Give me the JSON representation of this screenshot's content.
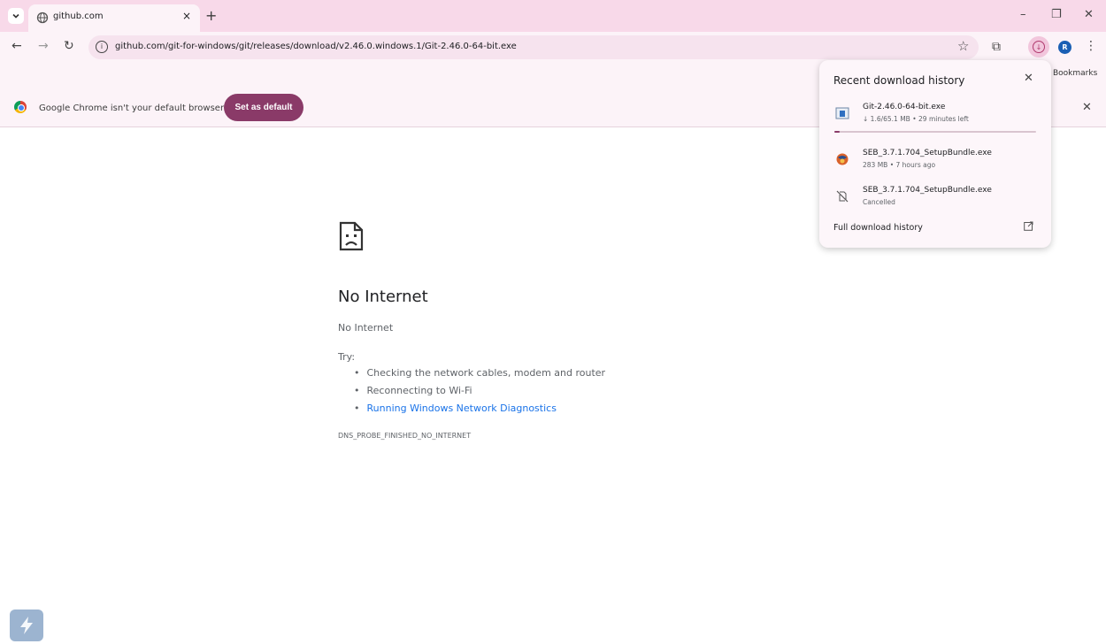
{
  "tab": {
    "title": "github.com",
    "close_glyph": "×",
    "new_tab_glyph": "+",
    "favicon": "globe-icon"
  },
  "window_controls": {
    "minimize": "–",
    "restore": "❐",
    "close": "✕"
  },
  "toolbar": {
    "url": "github.com/git-for-windows/git/releases/download/v2.46.0.windows.1/Git-2.46.0-64-bit.exe",
    "avatar_letter": "R",
    "bookmarks_label": "Bookmarks"
  },
  "infobar": {
    "message": "Google Chrome isn't your default browser",
    "button": "Set as default"
  },
  "error": {
    "title": "No Internet",
    "subtitle": "No Internet",
    "try_label": "Try:",
    "suggestions": [
      "Checking the network cables, modem and router",
      "Reconnecting to Wi-Fi",
      "Running Windows Network Diagnostics"
    ],
    "code": "DNS_PROBE_FINISHED_NO_INTERNET"
  },
  "downloads": {
    "header": "Recent download history",
    "items": [
      {
        "name": "Git-2.46.0-64-bit.exe",
        "meta": "↓ 1.6/65.1 MB • 29 minutes left",
        "progress": 0.025,
        "icon": "installer-icon"
      },
      {
        "name": "SEB_3.7.1.704_SetupBundle.exe",
        "meta": "283 MB • 7 hours ago",
        "icon": "seb-icon"
      },
      {
        "name": "SEB_3.7.1.704_SetupBundle.exe",
        "meta": "Cancelled",
        "icon": "cancelled-file-icon"
      }
    ],
    "full_history": "Full download history"
  },
  "colors": {
    "tabstrip": "#f8d9e9",
    "toolbar": "#fcf3f8",
    "accent": "#8a3a68",
    "link": "#1a73e8"
  }
}
